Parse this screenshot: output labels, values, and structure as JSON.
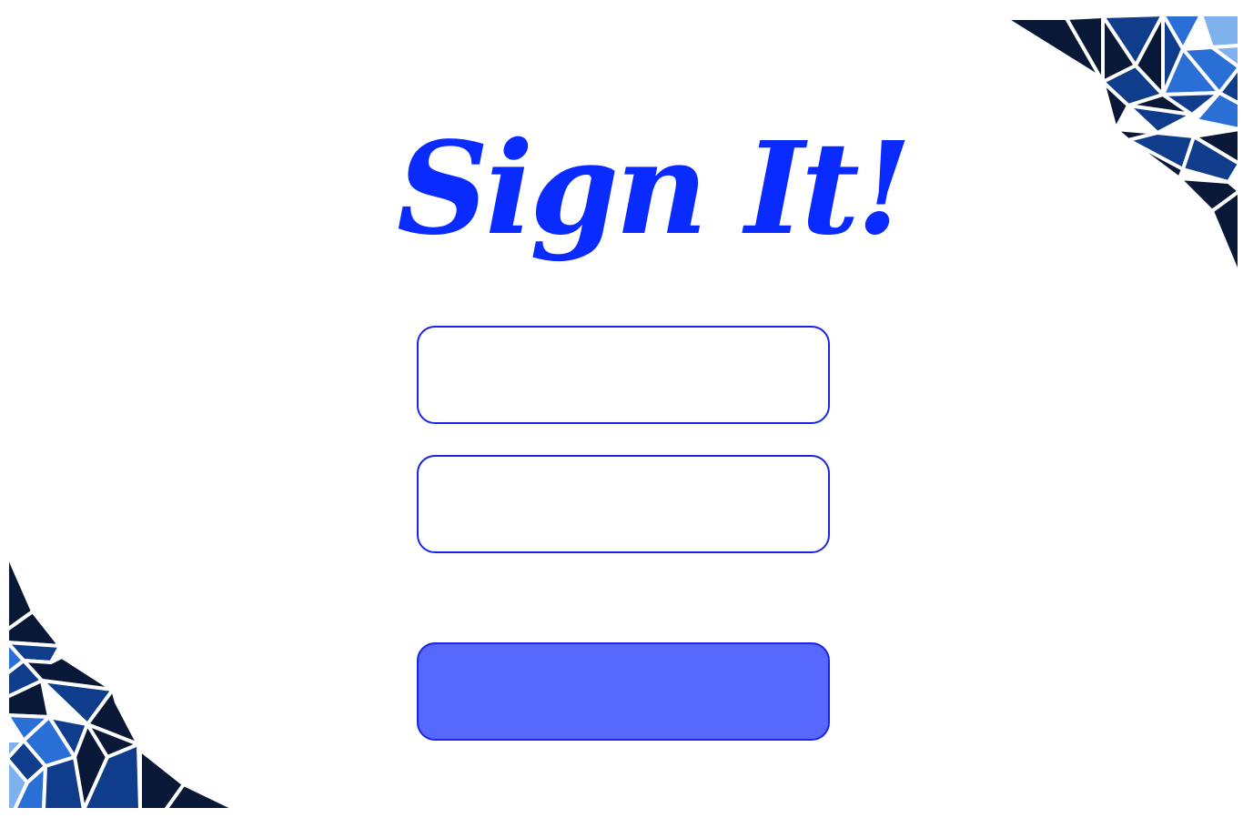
{
  "logo": {
    "text": "Sign It!",
    "color": "#0a2bff"
  },
  "form": {
    "field_1": {
      "value": "",
      "placeholder": ""
    },
    "field_2": {
      "value": "",
      "placeholder": ""
    },
    "submit_label": ""
  },
  "colors": {
    "accent": "#0a2bff",
    "field_border": "#1a23e6",
    "button_fill": "#5768ff",
    "decor_navy": "#0a1838",
    "decor_blue": "#0f3d8c",
    "decor_mid": "#2a6fd6",
    "decor_light": "#7fb1ee"
  }
}
